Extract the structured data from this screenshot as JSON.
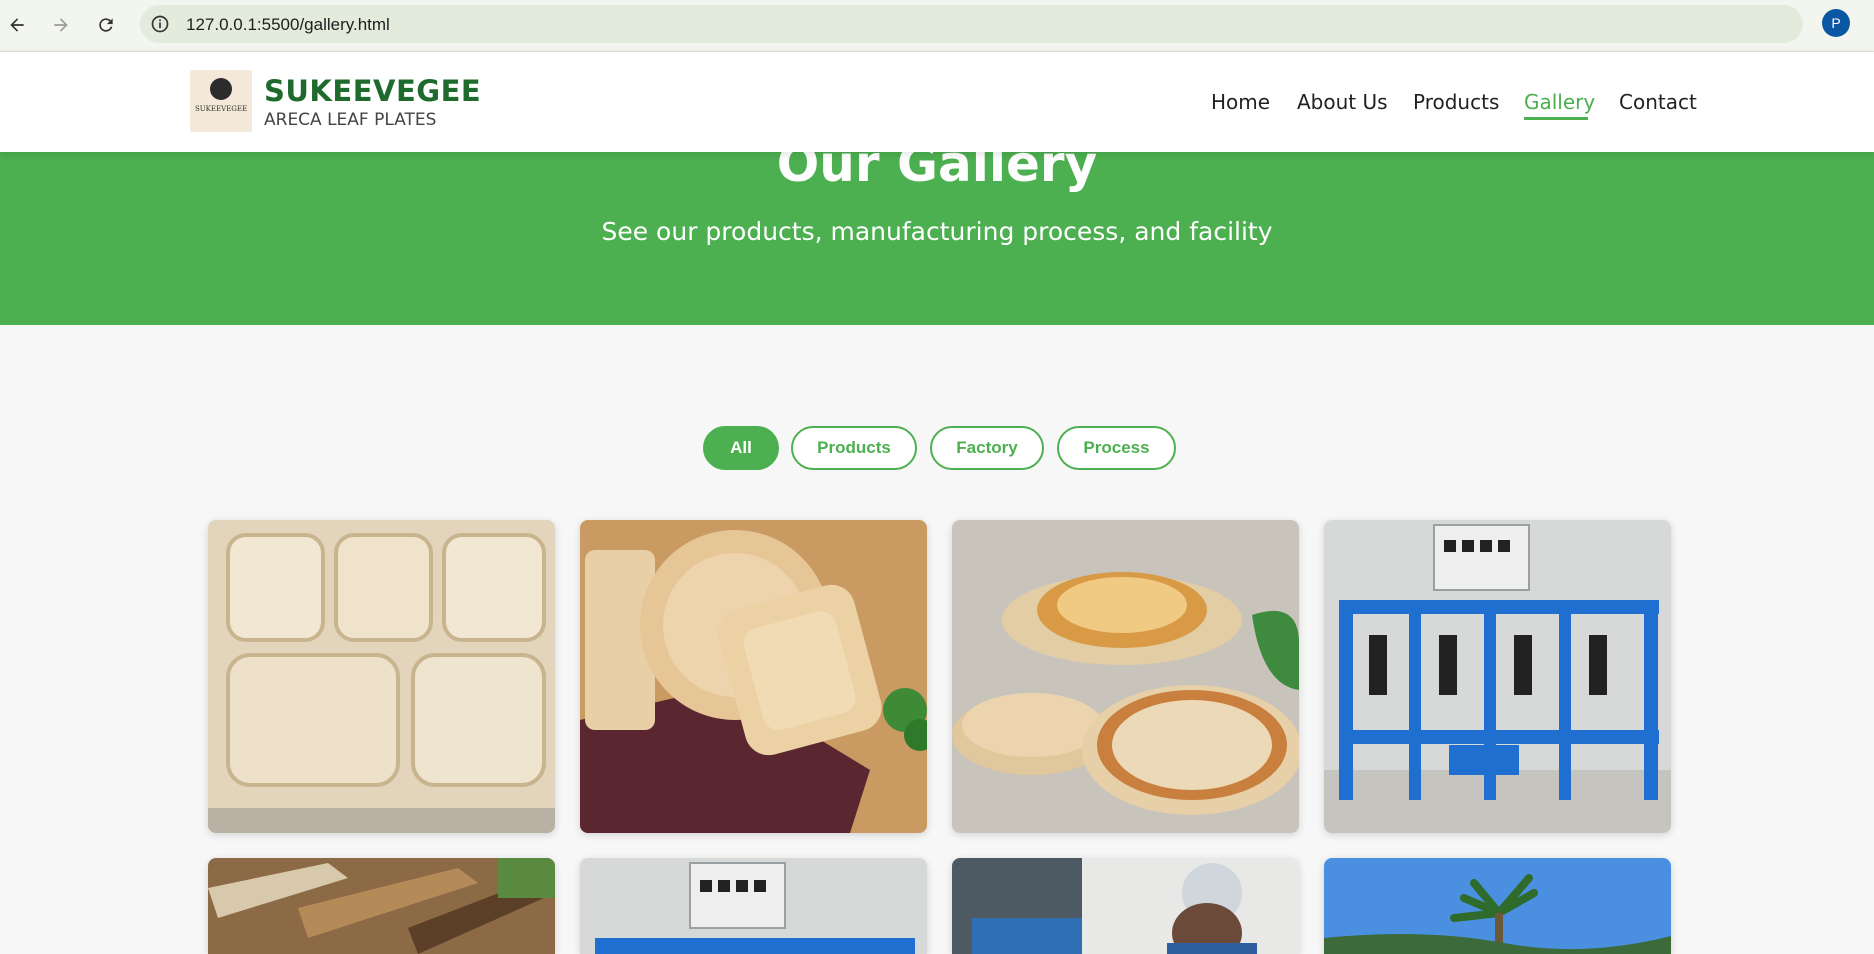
{
  "browser": {
    "url": "127.0.0.1:5500/gallery.html",
    "profile_initial": "P"
  },
  "header": {
    "logo_text": "SUKEEVEGEE",
    "brand_name": "SUKEEVEGEE",
    "brand_tagline": "ARECA LEAF PLATES",
    "nav": [
      {
        "label": "Home"
      },
      {
        "label": "About Us"
      },
      {
        "label": "Products"
      },
      {
        "label": "Gallery"
      },
      {
        "label": "Contact"
      }
    ],
    "active_nav": "Gallery"
  },
  "hero": {
    "title": "Our Gallery",
    "subtitle": "See our products, manufacturing process, and facility"
  },
  "filters": [
    {
      "label": "All",
      "active": true
    },
    {
      "label": "Products",
      "active": false
    },
    {
      "label": "Factory",
      "active": false
    },
    {
      "label": "Process",
      "active": false
    }
  ],
  "gallery": [
    {
      "subject": "compartment-tray"
    },
    {
      "subject": "plates-and-cutlery"
    },
    {
      "subject": "bowls-and-plates-stack"
    },
    {
      "subject": "plate-making-machine"
    },
    {
      "subject": "dried-areca-sheaths"
    },
    {
      "subject": "plate-making-machine"
    },
    {
      "subject": "worker-operating-press"
    },
    {
      "subject": "areca-palm-tree"
    }
  ],
  "colors": {
    "accent": "#4caf50",
    "brand_dark": "#1e6b2d",
    "profile": "#0b57a4"
  }
}
